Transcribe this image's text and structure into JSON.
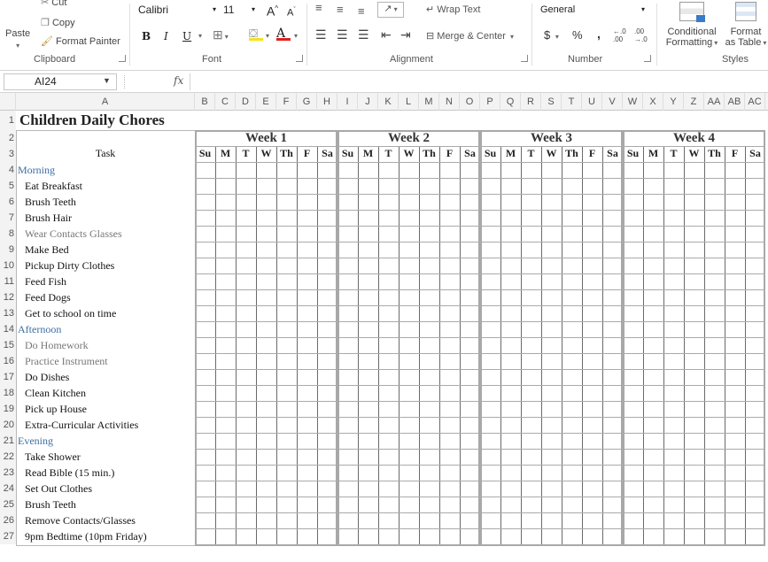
{
  "ribbon": {
    "clipboard": {
      "paste": "Paste",
      "cut": "Cut",
      "copy": "Copy",
      "format_painter": "Format Painter",
      "label": "Clipboard"
    },
    "font": {
      "name": "Calibri",
      "size": "11",
      "bold": "B",
      "italic": "I",
      "underline": "U",
      "font_color": "A",
      "label": "Font"
    },
    "alignment": {
      "wrap_text": "Wrap Text",
      "merge_center": "Merge & Center",
      "label": "Alignment"
    },
    "number": {
      "format": "General",
      "currency": "$",
      "percent": "%",
      "comma": ",",
      "label": "Number"
    },
    "styles": {
      "conditional_formatting": "Conditional",
      "conditional_formatting_2": "Formatting",
      "format_as_table": "Format",
      "format_as_table_2": "as Table",
      "label": "Styles"
    }
  },
  "formula_bar": {
    "name_box": "AI24",
    "fx": "fx",
    "formula": ""
  },
  "columns": [
    "A",
    "B",
    "C",
    "D",
    "E",
    "F",
    "G",
    "H",
    "I",
    "J",
    "K",
    "L",
    "M",
    "N",
    "O",
    "P",
    "Q",
    "R",
    "S",
    "T",
    "U",
    "V",
    "W",
    "X",
    "Y",
    "Z",
    "AA",
    "AB",
    "AC"
  ],
  "rows": [
    "1",
    "2",
    "3",
    "4",
    "5",
    "6",
    "7",
    "8",
    "9",
    "10",
    "11",
    "12",
    "13",
    "14",
    "15",
    "16",
    "17",
    "18",
    "19",
    "20",
    "21",
    "22",
    "23",
    "24",
    "25",
    "26",
    "27"
  ],
  "sheet": {
    "title": "Children Daily Chores",
    "task_header": "Task",
    "weeks": [
      "Week 1",
      "Week 2",
      "Week 3",
      "Week 4"
    ],
    "days": [
      "Su",
      "M",
      "T",
      "W",
      "Th",
      "F",
      "Sa"
    ],
    "tasks": [
      {
        "text": "Morning",
        "kind": "section"
      },
      {
        "text": "Eat Breakfast",
        "kind": "task"
      },
      {
        "text": "Brush Teeth",
        "kind": "task"
      },
      {
        "text": "Brush Hair",
        "kind": "task"
      },
      {
        "text": "Wear Contacts Glasses",
        "kind": "gray"
      },
      {
        "text": "Make Bed",
        "kind": "task"
      },
      {
        "text": "Pickup Dirty Clothes",
        "kind": "task"
      },
      {
        "text": "Feed Fish",
        "kind": "task"
      },
      {
        "text": "Feed Dogs",
        "kind": "task"
      },
      {
        "text": "Get to school on time",
        "kind": "task"
      },
      {
        "text": "Afternoon",
        "kind": "section"
      },
      {
        "text": "Do Homework",
        "kind": "gray"
      },
      {
        "text": "Practice Instrument",
        "kind": "gray"
      },
      {
        "text": "Do Dishes",
        "kind": "task"
      },
      {
        "text": "Clean Kitchen",
        "kind": "task"
      },
      {
        "text": "Pick up House",
        "kind": "task"
      },
      {
        "text": "Extra-Curricular Activities",
        "kind": "task"
      },
      {
        "text": "Evening",
        "kind": "section"
      },
      {
        "text": "Take Shower",
        "kind": "task"
      },
      {
        "text": "Read Bible (15 min.)",
        "kind": "task"
      },
      {
        "text": "Set Out Clothes",
        "kind": "task"
      },
      {
        "text": "Brush Teeth",
        "kind": "task"
      },
      {
        "text": "Remove Contacts/Glasses",
        "kind": "task"
      },
      {
        "text": "9pm Bedtime (10pm Friday)",
        "kind": "task"
      }
    ]
  }
}
